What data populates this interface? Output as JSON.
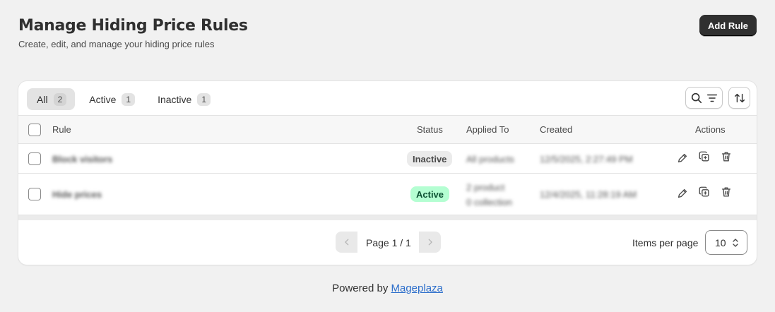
{
  "header": {
    "title": "Manage Hiding Price Rules",
    "subtitle": "Create, edit, and manage your hiding price rules",
    "add_button": "Add Rule"
  },
  "tabs": [
    {
      "label": "All",
      "count": "2",
      "selected": true
    },
    {
      "label": "Active",
      "count": "1",
      "selected": false
    },
    {
      "label": "Inactive",
      "count": "1",
      "selected": false
    }
  ],
  "toolbar": {
    "search_filter_icon": "search-filter-icon",
    "sort_icon": "sort-icon"
  },
  "table": {
    "columns": {
      "rule": "Rule",
      "status": "Status",
      "applied_to": "Applied To",
      "created": "Created",
      "actions": "Actions"
    },
    "rows": [
      {
        "rule": "Block visitors",
        "status": "Inactive",
        "applied_to_line1": "All products",
        "applied_to_line2": "",
        "created": "12/5/2025, 2:27:49 PM"
      },
      {
        "rule": "Hide prices",
        "status": "Active",
        "applied_to_line1": "2 product",
        "applied_to_line2": "0 collection",
        "created": "12/4/2025, 11:28:19 AM"
      }
    ],
    "action_icons": [
      "edit-icon",
      "duplicate-icon",
      "delete-icon"
    ]
  },
  "pagination": {
    "page_label": "Page 1 / 1",
    "items_per_page_label": "Items per page",
    "items_per_page_value": "10"
  },
  "footer": {
    "powered_by": "Powered by",
    "brand_link": "Mageplaza"
  },
  "colors": {
    "primary_button": "#303030",
    "active_badge_bg": "#b4fed2",
    "active_badge_text": "#0c5132",
    "inactive_badge_bg": "#ebebeb",
    "link": "#2c6ecb",
    "page_bg": "#f1f1f1"
  }
}
